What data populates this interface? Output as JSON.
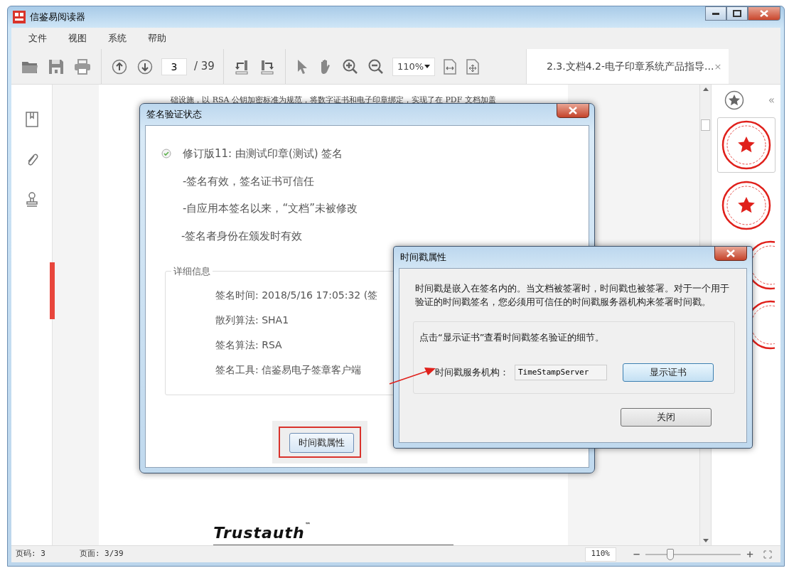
{
  "window": {
    "title": "信鉴易阅读器"
  },
  "menu": [
    {
      "label": "文件"
    },
    {
      "label": "视图"
    },
    {
      "label": "系统"
    },
    {
      "label": "帮助"
    }
  ],
  "toolbar": {
    "page_input": "3",
    "page_total": "/ 39",
    "zoom": "110%"
  },
  "tabs": [
    {
      "label": "2.3.文档4.2-电子印章系统产品指导...",
      "selected": true,
      "close": "×"
    }
  ],
  "document": {
    "text_line": "础设施，以 RSA 公钥加密标准为规范，将数字证书和电子印章绑定，实现了在 PDF 文档加盖",
    "logo": "Trustauth",
    "trademark": "™"
  },
  "stamp_panel": {
    "collapse": "«"
  },
  "signature_dialog": {
    "title": "签名验证状态",
    "summary": "修订版11: 由测试印章(测试) 签名",
    "status_lines": [
      "-签名有效，签名证书可信任",
      "-自应用本签名以来，“文档”未被修改",
      "-签名者身份在颁发时有效"
    ],
    "details_legend": "详细信息",
    "details": [
      "签名时间: 2018/5/16 17:05:32 (签",
      "散列算法: SHA1",
      "签名算法: RSA",
      "签名工具: 信鉴易电子签章客户端"
    ],
    "button": "时间戳属性"
  },
  "timestamp_dialog": {
    "title": "时间戳属性",
    "description": "时间戳是嵌入在签名内的。当文档被签署时，时间戳也被签署。对于一个用于验证的时间戳签名，您必须用可信任的时间戳服务器机构来签署时间戳。",
    "instruction": "点击“显示证书”查看时间戳签名验证的细节。",
    "authority_label": "时间戳服务机构：",
    "authority_value": "TimeStampServer",
    "show_cert_button": "显示证书",
    "close_button": "关闭"
  },
  "status_bar": {
    "page_number": "页码: 3",
    "page_count": "页面: 3/39",
    "zoom": "110%",
    "minus": "−",
    "plus": "+",
    "zoom_slider": {
      "level": 0.26
    }
  }
}
